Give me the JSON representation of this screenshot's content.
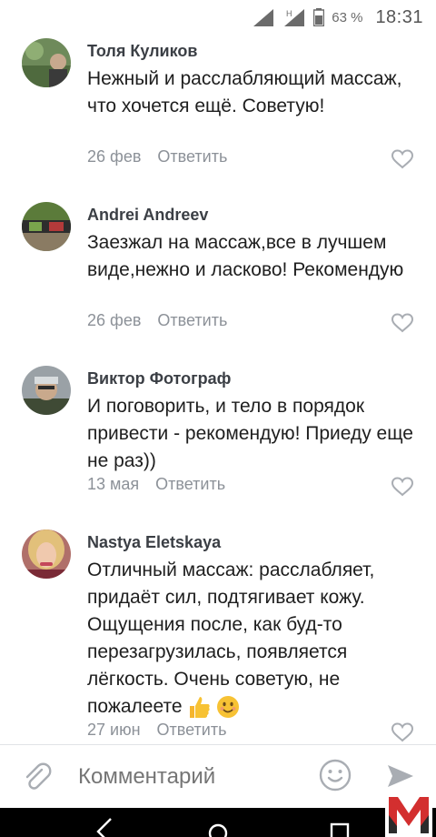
{
  "status_bar": {
    "network_type": "H",
    "battery_percent": "63 %",
    "time": "18:31"
  },
  "comments": [
    {
      "author": "Толя Куликов",
      "text": "Нежный и расслабляющий массаж, что хочется ещё. Советую!",
      "date": "26 фев",
      "reply_label": "Ответить",
      "avatar_icon": "user-avatar-icon"
    },
    {
      "author": "Andrei Andreev",
      "text": "Заезжал на массаж,все в лучшем виде,нежно и ласково! Рекомендую",
      "date": "26 фев",
      "reply_label": "Ответить",
      "avatar_icon": "user-avatar-icon"
    },
    {
      "author": "Виктор Фотограф",
      "text": "И поговорить,  и тело в порядок привести - рекомендую! Приеду еще не раз))",
      "date": "13 мая",
      "reply_label": "Ответить",
      "avatar_icon": "user-avatar-icon"
    },
    {
      "author": "Nastya Eletskaya",
      "text": "Отличный массаж: расслабляет, придаёт сил, подтягивает кожу. Ощущения после, как буд-то перезагрузилась, появляется лёгкость. Очень советую, не пожалеете",
      "text_emoji": [
        "thumbs-up-emoji",
        "smiling-face-emoji"
      ],
      "date": "27 июн",
      "reply_label": "Ответить",
      "avatar_icon": "user-avatar-icon"
    }
  ],
  "composer": {
    "placeholder": "Комментарий",
    "attach_icon": "paperclip-icon",
    "emoji_icon": "smile-icon",
    "send_icon": "send-icon"
  },
  "colors": {
    "author": "#3b3f45",
    "body_text": "#1e1e1e",
    "meta_text": "#8c9198",
    "icon_gray": "#a9adb3",
    "logo_red": "#d32f2f"
  },
  "watermark": "M"
}
